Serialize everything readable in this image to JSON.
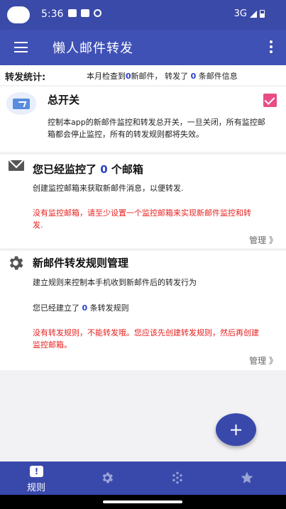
{
  "status_bar": {
    "time": "5:36",
    "network": "3G"
  },
  "app_bar": {
    "title": "懒人邮件转发"
  },
  "stats": {
    "label": "转发统计:",
    "prefix": "本月检查到",
    "checked_count": "0",
    "middle": "新邮件， 转发了 ",
    "forwarded_count": "0",
    "suffix": " 条邮件信息"
  },
  "master_switch": {
    "title": "总开关",
    "description": "控制本app的新邮件监控和转发总开关，一旦关闭，所有监控邮箱都会停止监控，所有的转发规则都将失效。",
    "checked": true
  },
  "monitored_mailboxes": {
    "title_prefix": "您已经监控了 ",
    "count": "0",
    "title_suffix": " 个邮箱",
    "description": "创建监控邮箱来获取新邮件消息，以便转发.",
    "warning": "没有监控邮箱，请至少设置一个监控邮箱来实现新邮件监控和转发.",
    "manage_label": "管理 》"
  },
  "forward_rules": {
    "title": "新邮件转发规则管理",
    "description": "建立规则来控制本手机收到新邮件后的转发行为",
    "count_prefix": "您已经建立了 ",
    "count": "0",
    "count_suffix": " 条转发规则",
    "warning": "没有转发规则，不能转发哦。您应该先创建转发规则，然后再创建监控邮箱。",
    "manage_label": "管理 》"
  },
  "fab": {
    "label": "+"
  },
  "bottom_nav": {
    "items": [
      {
        "label": "规则",
        "icon": "rules-icon",
        "active": true
      },
      {
        "label": "",
        "icon": "settings-icon"
      },
      {
        "label": "",
        "icon": "scan-icon"
      },
      {
        "label": "",
        "icon": "star-icon"
      }
    ]
  },
  "colors": {
    "primary": "#3f51b5",
    "accent": "#e84d86",
    "warning": "#e82020",
    "highlight": "#2a41c8"
  }
}
